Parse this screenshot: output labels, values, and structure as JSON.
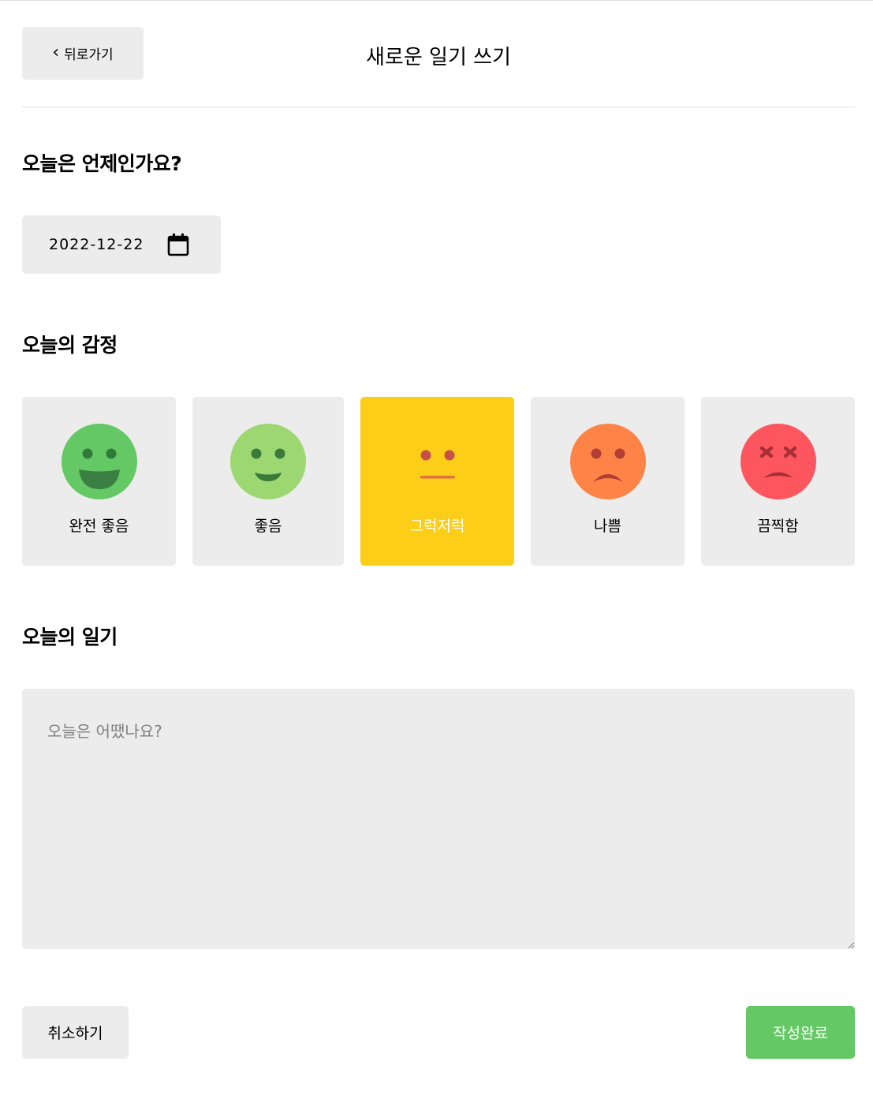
{
  "header": {
    "back_label": "뒤로가기",
    "title": "새로운 일기 쓰기"
  },
  "date_section": {
    "title": "오늘은 언제인가요?",
    "date_value": "2022-12-22",
    "calendar_icon": "calendar-icon"
  },
  "emotion_section": {
    "title": "오늘의 감정",
    "selected_index": 2,
    "items": [
      {
        "label": "완전 좋음",
        "icon": "very-happy-face-icon",
        "color": "#64c964"
      },
      {
        "label": "좋음",
        "icon": "happy-face-icon",
        "color": "#9dd772"
      },
      {
        "label": "그럭저럭",
        "icon": "neutral-face-icon",
        "color": "#fdce17"
      },
      {
        "label": "나쁨",
        "icon": "sad-face-icon",
        "color": "#fd8446"
      },
      {
        "label": "끔찍함",
        "icon": "terrible-face-icon",
        "color": "#fd565f"
      }
    ]
  },
  "diary_section": {
    "title": "오늘의 일기",
    "content_value": "",
    "content_placeholder": "오늘은 어땠나요?"
  },
  "footer": {
    "cancel_label": "취소하기",
    "submit_label": "작성완료",
    "submit_color": "#64c964"
  }
}
